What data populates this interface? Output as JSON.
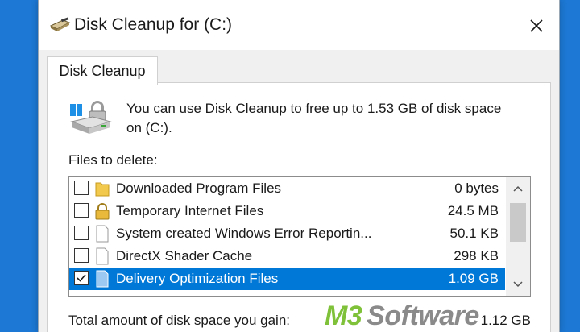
{
  "window": {
    "title": "Disk Cleanup for  (C:)",
    "tab_label": "Disk Cleanup"
  },
  "info": {
    "message": "You can use Disk Cleanup to free up to 1.53 GB of disk space on  (C:)."
  },
  "files": {
    "label": "Files to delete:",
    "items": [
      {
        "name": "Downloaded Program Files",
        "size": "0 bytes",
        "checked": false,
        "icon": "folder-icon",
        "selected": false
      },
      {
        "name": "Temporary Internet Files",
        "size": "24.5 MB",
        "checked": false,
        "icon": "lock-icon",
        "selected": false
      },
      {
        "name": "System created Windows Error Reportin...",
        "size": "50.1 KB",
        "checked": false,
        "icon": "file-icon",
        "selected": false
      },
      {
        "name": "DirectX Shader Cache",
        "size": "298 KB",
        "checked": false,
        "icon": "file-icon",
        "selected": false
      },
      {
        "name": "Delivery Optimization Files",
        "size": "1.09 GB",
        "checked": true,
        "icon": "file-blue-icon",
        "selected": true
      }
    ]
  },
  "total": {
    "label": "Total amount of disk space you gain:",
    "value": "1.12 GB"
  },
  "watermark": {
    "brand_a": "M3",
    "brand_b": "Software"
  },
  "colors": {
    "selection": "#0078d7",
    "watermark_green": "#7fc23a",
    "watermark_gray": "#8a8a8a"
  }
}
